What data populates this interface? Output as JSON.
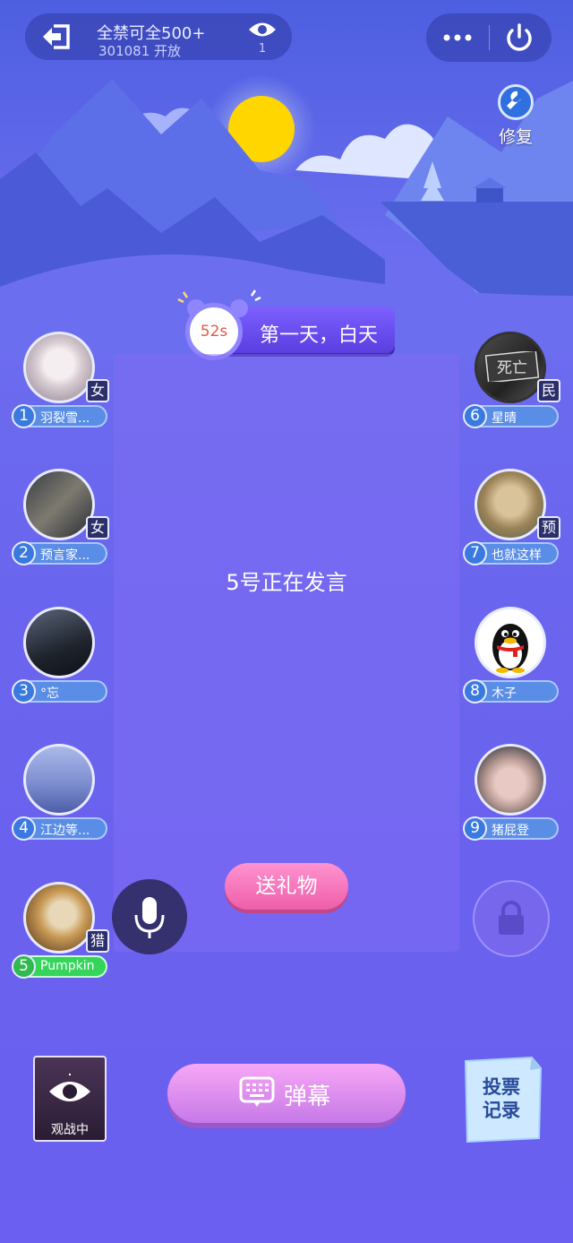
{
  "top_bar": {
    "room_title": "全禁可全500+",
    "room_subtitle": "301081 开放",
    "viewer_count": "1"
  },
  "repair": {
    "label": "修复"
  },
  "timer": {
    "seconds": "52s",
    "phase": "第一天，白天"
  },
  "status": {
    "speaking": "5号正在发言"
  },
  "gift_button": "送礼物",
  "seats": [
    {
      "num": "1",
      "name": "羽裂雪...",
      "role": "女"
    },
    {
      "num": "2",
      "name": "预言家...",
      "role": "女"
    },
    {
      "num": "3",
      "name": "°忘",
      "role": ""
    },
    {
      "num": "4",
      "name": "江边等...",
      "role": ""
    },
    {
      "num": "5",
      "name": "Pumpkin",
      "role": "猎"
    },
    {
      "num": "6",
      "name": "星晴",
      "role": "民",
      "overlay": "死亡"
    },
    {
      "num": "7",
      "name": "也就这样",
      "role": "预"
    },
    {
      "num": "8",
      "name": "木子",
      "role": ""
    },
    {
      "num": "9",
      "name": "猪屁登",
      "role": ""
    }
  ],
  "bottom": {
    "spectate_label": "观战中",
    "barrage_label": "弹幕",
    "vote_label_1": "投票",
    "vote_label_2": "记录"
  },
  "colors": {
    "accent": "#6a64ee",
    "active_seat": "#35d45a",
    "gift": "#ee5fa9"
  }
}
